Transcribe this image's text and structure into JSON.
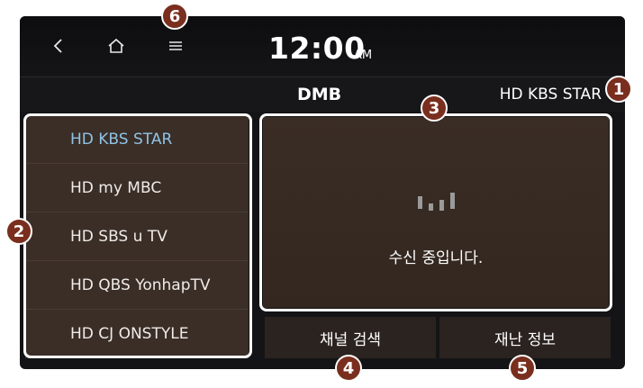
{
  "topbar": {
    "back_icon": "back-chevron-icon",
    "home_icon": "home-icon",
    "menu_icon": "menu-icon",
    "clock_time": "12:00",
    "clock_ampm": "AM"
  },
  "header": {
    "title": "DMB",
    "current_station": "HD KBS STAR"
  },
  "channel_list": {
    "items": [
      {
        "label": "HD KBS STAR",
        "active": true
      },
      {
        "label": "HD my MBC",
        "active": false
      },
      {
        "label": "HD SBS u TV",
        "active": false
      },
      {
        "label": "HD QBS YonhapTV",
        "active": false
      },
      {
        "label": "HD CJ ONSTYLE",
        "active": false
      }
    ]
  },
  "main": {
    "signal_icon": "signal-bars-icon",
    "status_text": "수신 중입니다."
  },
  "buttons": {
    "channel_search": "채널 검색",
    "disaster_info": "재난 정보"
  },
  "callouts": {
    "c1": "1",
    "c2": "2",
    "c3": "3",
    "c4": "4",
    "c5": "5",
    "c6": "6"
  },
  "colors": {
    "active_channel": "#8fc3e6",
    "panel_brown": "#3a2e27",
    "badge": "#7a2e1e"
  }
}
